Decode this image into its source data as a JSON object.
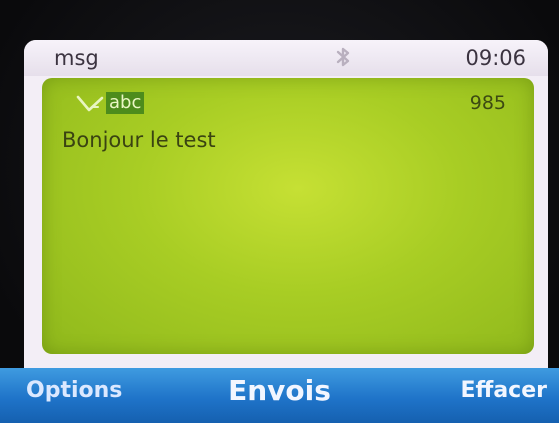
{
  "status_bar": {
    "app_name": "msg",
    "time": "09:06",
    "status_icon": "bluetooth-icon"
  },
  "editor": {
    "input_icon": "pen-icon",
    "input_mode": "abc",
    "char_count": "985",
    "message": "Bonjour le test"
  },
  "softkeys": {
    "left": "Options",
    "center": "Envois",
    "right": "Effacer"
  },
  "colors": {
    "editor_green": "#a8cd24",
    "softkey_blue": "#1f74c9"
  }
}
